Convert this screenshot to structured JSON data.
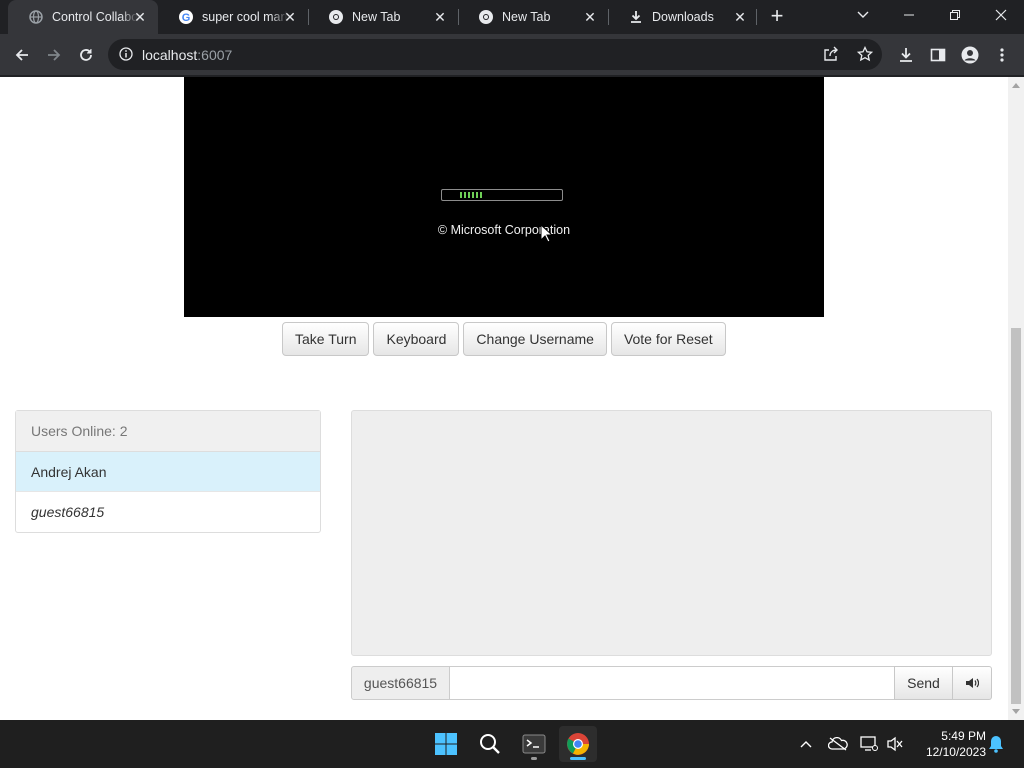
{
  "browser": {
    "tabs": [
      {
        "title": "Control Collaborative",
        "active": true
      },
      {
        "title": "super cool marketplace"
      },
      {
        "title": "New Tab"
      },
      {
        "title": "New Tab"
      },
      {
        "title": "Downloads"
      }
    ],
    "url_host": "localhost",
    "url_port": ":6007"
  },
  "vm": {
    "copyright": "© Microsoft Corporation"
  },
  "controls": {
    "take_turn": "Take Turn",
    "keyboard": "Keyboard",
    "change_username": "Change Username",
    "vote_reset": "Vote for Reset"
  },
  "users": {
    "header": "Users Online: 2",
    "list": [
      {
        "name": "Andrej Akan"
      },
      {
        "name": "guest66815"
      }
    ]
  },
  "chat": {
    "username": "guest66815",
    "input_value": "",
    "send_label": "Send"
  },
  "taskbar": {
    "time": "5:49 PM",
    "date": "12/10/2023"
  },
  "colors": {
    "chrome_bg": "#202124",
    "toolbar_bg": "#35363a",
    "selected_user": "#d9f1fb",
    "boot_bar": "#6fcf57"
  }
}
